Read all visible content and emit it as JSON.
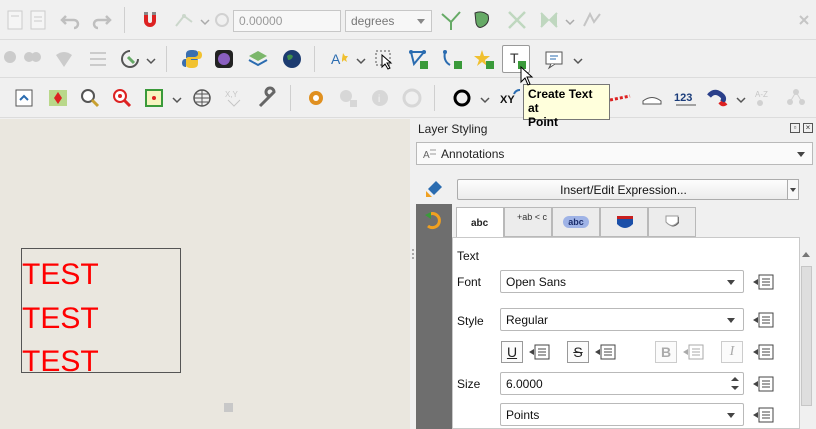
{
  "toolbar1": {
    "rotation_value": "0.00000",
    "angle_unit": "degrees"
  },
  "tooltip": {
    "line1": "Create Text at",
    "line2": "Point"
  },
  "toolbar3": {
    "xy_label": "XY",
    "count_label": "123"
  },
  "canvas": {
    "lines": [
      "TEST",
      "TEST",
      "TEST"
    ],
    "text_color": "#ff0000"
  },
  "panel": {
    "title": "Layer Styling",
    "layer": "Annotations",
    "expression_button": "Insert/Edit Expression...",
    "tabs": [
      {
        "icon": "text-tab-icon",
        "label": "abc"
      },
      {
        "icon": "formatting-tab-icon",
        "label": "+ab < c"
      },
      {
        "icon": "buffer-tab-icon",
        "label": "abc"
      },
      {
        "icon": "background-tab-icon",
        "label": ""
      },
      {
        "icon": "shadow-tab-icon",
        "label": ""
      }
    ],
    "section": "Text",
    "font_label": "Font",
    "font_value": "Open Sans",
    "style_label": "Style",
    "style_value": "Regular",
    "format_buttons": [
      "U",
      "S",
      "B",
      "I"
    ],
    "size_label": "Size",
    "size_value": "6.0000",
    "unit_value": "Points"
  }
}
